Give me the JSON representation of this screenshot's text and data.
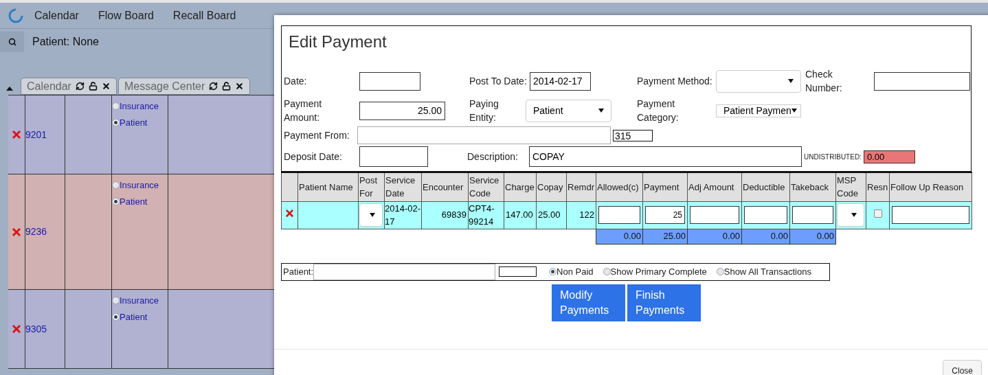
{
  "menu": [
    "Calendar",
    "Flow Board",
    "Recall Board"
  ],
  "patient_label": "Patient: None",
  "tabs": [
    {
      "label": "Calendar"
    },
    {
      "label": "Message Center"
    }
  ],
  "appointments": [
    {
      "id": "9201",
      "color": "#b1b1d1",
      "options": [
        {
          "label": "Insurance",
          "selected": false
        },
        {
          "label": "Patient",
          "selected": true
        }
      ]
    },
    {
      "id": "9236",
      "color": "#d1b1b1",
      "options": [
        {
          "label": "Insurance",
          "selected": false
        },
        {
          "label": "Patient",
          "selected": true
        }
      ]
    },
    {
      "id": "9305",
      "color": "#b1b1d1",
      "options": [
        {
          "label": "Insurance",
          "selected": false
        },
        {
          "label": "Patient",
          "selected": true
        }
      ]
    }
  ],
  "dialog": {
    "title": "Edit Payment",
    "date": {
      "label": "Date:"
    },
    "post_to_date": {
      "label": "Post To Date:",
      "value": "2014-02-17"
    },
    "payment_method": {
      "label": "Payment Method:"
    },
    "check_number": {
      "label": "Check Number:"
    },
    "payment_amount": {
      "label": "Payment Amount:",
      "value": "25.00"
    },
    "paying_entity": {
      "label": "Paying Entity:",
      "value": "Patient"
    },
    "payment_category": {
      "label": "Payment Category:",
      "value": "Patient Paymen"
    },
    "payment_from": {
      "label": "Payment From:",
      "code": "315"
    },
    "deposit_date": {
      "label": "Deposit Date:"
    },
    "description": {
      "label": "Description:",
      "value": "COPAY"
    },
    "undistributed": {
      "label": "UNDISTRIBUTED:",
      "value": "0.00"
    },
    "table": {
      "columns": [
        "Patient Name",
        "Post For",
        "Service Date",
        "Encounter",
        "Service Code",
        "Charge",
        "Copay",
        "Remdr",
        "Allowed(c)",
        "Payment",
        "Adj Amount",
        "Deductible",
        "Takeback",
        "MSP Code",
        "Resn",
        "Follow Up Reason"
      ],
      "rows": [
        {
          "service_date": "2014-02-17",
          "encounter": "69839",
          "service_code": "CPT4-99214",
          "charge": "147.00",
          "copay": "25.00",
          "remdr": "122",
          "payment": "25",
          "resn_checked": false
        }
      ],
      "totals": [
        "0.00",
        "25.00",
        "0.00",
        "0.00",
        "0.00"
      ]
    },
    "filter": {
      "label": "Patient:",
      "options": [
        {
          "label": "Non Paid",
          "selected": true
        },
        {
          "label": "Show Primary Complete",
          "selected": false
        },
        {
          "label": "Show All Transactions",
          "selected": false
        }
      ]
    },
    "buttons": [
      "Modify Payments",
      "Finish Payments"
    ],
    "close": "Close"
  }
}
